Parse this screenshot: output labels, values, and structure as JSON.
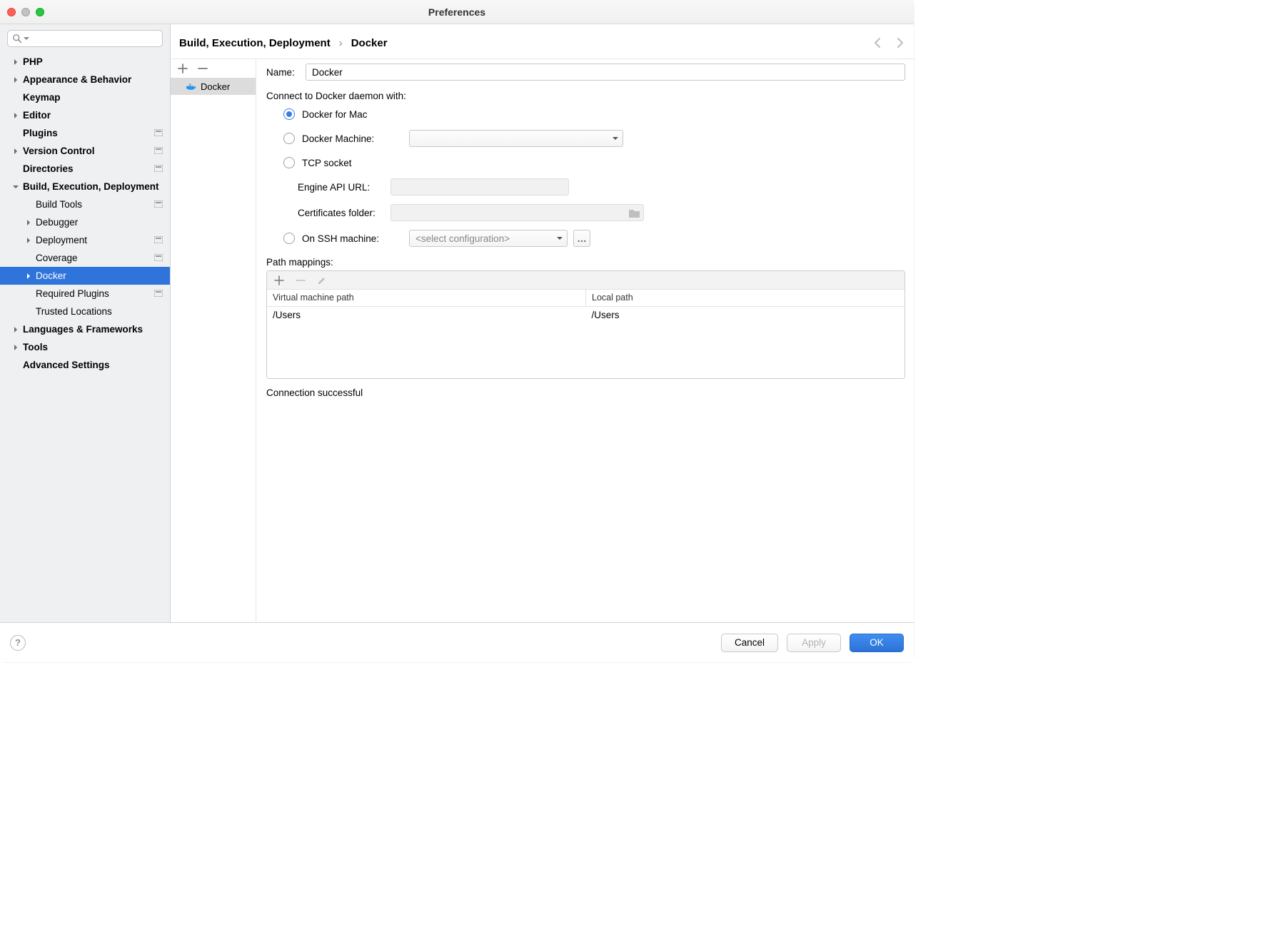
{
  "window_title": "Preferences",
  "sidebar": {
    "search_placeholder": "",
    "items": [
      {
        "label": "PHP",
        "bold": true,
        "depth": 0,
        "expandable": true,
        "expanded": false,
        "badge": false,
        "selected": false
      },
      {
        "label": "Appearance & Behavior",
        "bold": true,
        "depth": 0,
        "expandable": true,
        "expanded": false,
        "badge": false,
        "selected": false
      },
      {
        "label": "Keymap",
        "bold": true,
        "depth": 0,
        "expandable": false,
        "expanded": false,
        "badge": false,
        "selected": false
      },
      {
        "label": "Editor",
        "bold": true,
        "depth": 0,
        "expandable": true,
        "expanded": false,
        "badge": false,
        "selected": false
      },
      {
        "label": "Plugins",
        "bold": true,
        "depth": 0,
        "expandable": false,
        "expanded": false,
        "badge": true,
        "selected": false
      },
      {
        "label": "Version Control",
        "bold": true,
        "depth": 0,
        "expandable": true,
        "expanded": false,
        "badge": true,
        "selected": false
      },
      {
        "label": "Directories",
        "bold": true,
        "depth": 0,
        "expandable": false,
        "expanded": false,
        "badge": true,
        "selected": false
      },
      {
        "label": "Build, Execution, Deployment",
        "bold": true,
        "depth": 0,
        "expandable": true,
        "expanded": true,
        "badge": false,
        "selected": false
      },
      {
        "label": "Build Tools",
        "bold": false,
        "depth": 1,
        "expandable": false,
        "expanded": false,
        "badge": true,
        "selected": false
      },
      {
        "label": "Debugger",
        "bold": false,
        "depth": 1,
        "expandable": true,
        "expanded": false,
        "badge": false,
        "selected": false
      },
      {
        "label": "Deployment",
        "bold": false,
        "depth": 1,
        "expandable": true,
        "expanded": false,
        "badge": true,
        "selected": false
      },
      {
        "label": "Coverage",
        "bold": false,
        "depth": 1,
        "expandable": false,
        "expanded": false,
        "badge": true,
        "selected": false
      },
      {
        "label": "Docker",
        "bold": false,
        "depth": 1,
        "expandable": true,
        "expanded": false,
        "badge": false,
        "selected": true
      },
      {
        "label": "Required Plugins",
        "bold": false,
        "depth": 1,
        "expandable": false,
        "expanded": false,
        "badge": true,
        "selected": false
      },
      {
        "label": "Trusted Locations",
        "bold": false,
        "depth": 1,
        "expandable": false,
        "expanded": false,
        "badge": false,
        "selected": false
      },
      {
        "label": "Languages & Frameworks",
        "bold": true,
        "depth": 0,
        "expandable": true,
        "expanded": false,
        "badge": false,
        "selected": false
      },
      {
        "label": "Tools",
        "bold": true,
        "depth": 0,
        "expandable": true,
        "expanded": false,
        "badge": false,
        "selected": false
      },
      {
        "label": "Advanced Settings",
        "bold": true,
        "depth": 0,
        "expandable": false,
        "expanded": false,
        "badge": false,
        "selected": false
      }
    ]
  },
  "breadcrumb": {
    "a": "Build, Execution, Deployment",
    "sep": "›",
    "b": "Docker"
  },
  "list": {
    "item": "Docker"
  },
  "form": {
    "name_label": "Name:",
    "name_value": "Docker",
    "connect_heading": "Connect to Docker daemon with:",
    "opt_mac": "Docker for Mac",
    "opt_machine": "Docker Machine:",
    "opt_tcp": "TCP socket",
    "engine_api_label": "Engine API URL:",
    "certs_label": "Certificates folder:",
    "opt_ssh": "On SSH machine:",
    "ssh_placeholder": "<select configuration>",
    "mappings_heading": "Path mappings:",
    "mappings_cols": {
      "a": "Virtual machine path",
      "b": "Local path"
    },
    "mappings_row": {
      "a": "/Users",
      "b": "/Users"
    },
    "status": "Connection successful"
  },
  "buttons": {
    "cancel": "Cancel",
    "apply": "Apply",
    "ok": "OK"
  }
}
